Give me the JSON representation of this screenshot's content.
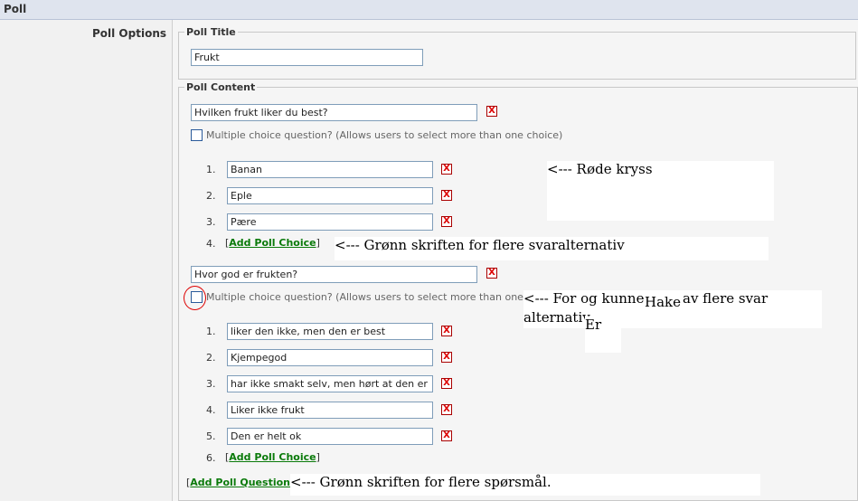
{
  "header": {
    "title": "Poll"
  },
  "sidebar": {
    "label": "Poll Options"
  },
  "poll_title": {
    "legend": "Poll Title",
    "value": "Frukt"
  },
  "poll_content": {
    "legend": "Poll Content",
    "delete_glyph": "X",
    "questions": [
      {
        "text": "Hvilken frukt liker du best?",
        "multiple_label": "Multiple choice question? (Allows users to select more than one choice)",
        "choices": [
          {
            "num": "1.",
            "value": "Banan"
          },
          {
            "num": "2.",
            "value": "Eple"
          },
          {
            "num": "3.",
            "value": "Pære"
          }
        ],
        "add_num": "4.",
        "add_label": "Add Poll Choice"
      },
      {
        "text": "Hvor god er frukten?",
        "multiple_label": "Multiple choice question? (Allows users to select more than one choice)",
        "choices": [
          {
            "num": "1.",
            "value": "liker den ikke, men den er best"
          },
          {
            "num": "2.",
            "value": "Kjempegod"
          },
          {
            "num": "3.",
            "value": "har ikke smakt selv, men hørt at den er"
          },
          {
            "num": "4.",
            "value": "Liker ikke frukt"
          },
          {
            "num": "5.",
            "value": "Den er helt ok"
          }
        ],
        "add_num": "6.",
        "add_label": "Add Poll Choice"
      }
    ],
    "add_question_label": "Add Poll Question"
  },
  "annotations": {
    "red_crosses": "<--- Røde kryss",
    "green_text_choices": "<---   Grønn skriften for flere svaralternativ",
    "checkbox_line1": "<--- For og kunne",
    "checkbox_hake": "Hake",
    "checkbox_line1b": "av flere svar",
    "checkbox_line2": "alternativ",
    "checkbox_er": "Er",
    "green_text_questions": "<--- Grønn skriften for flere spørsmål."
  },
  "colors": {
    "header_bg": "#dfe4ee",
    "sidebar_bg": "#f1f1f1",
    "link_green": "#0a7a0a",
    "delete_red": "#d00000"
  }
}
